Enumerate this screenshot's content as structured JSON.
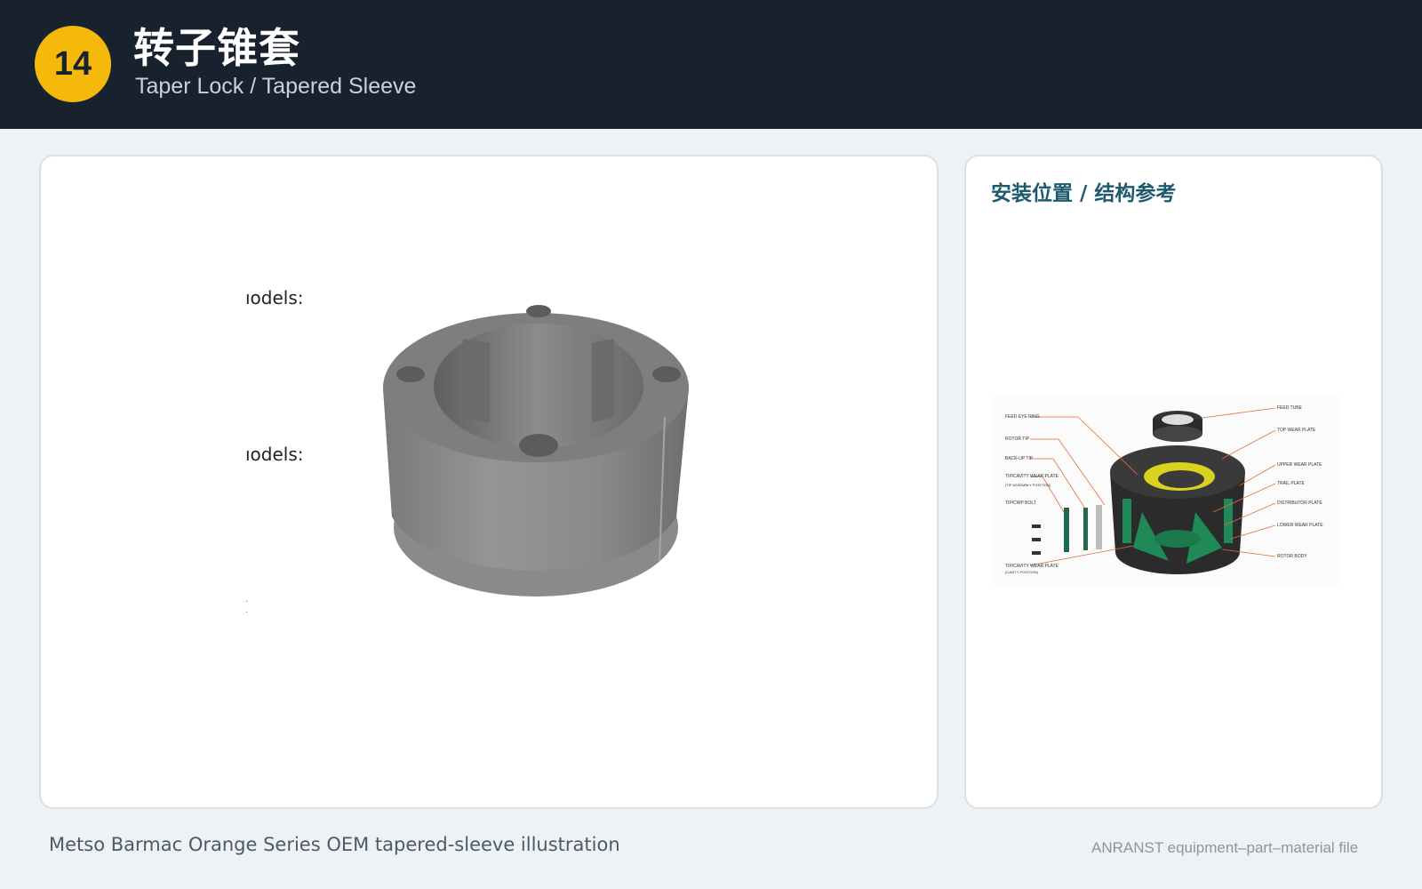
{
  "header": {
    "number": "14",
    "title_cn": "转子锥套",
    "title_en": "Taper Lock / Tapered Sleeve"
  },
  "main_image": {
    "fragments": [
      "ıodels:",
      "ıodels:"
    ]
  },
  "side_panel": {
    "title": "安装位置 / 结构参考",
    "diagram_labels_left": [
      "FEED EYE RING",
      "ROTOR TIP",
      "BACK-UP TIP",
      "TIP/CAVITY WEAR PLATE",
      "(TIP ASSEMBLY POSITION)",
      "TIP/CWP BOLT",
      "TIP/CAVITY WEAR PLATE",
      "(CAVITY POSITION)"
    ],
    "diagram_labels_right": [
      "FEED TUBE",
      "TOP WEAR PLATE",
      "UPPER WEAR PLATE",
      "TRAIL PLATE",
      "DISTRIBUTOR PLATE",
      "LOWER WEAR PLATE",
      "ROTOR BODY"
    ]
  },
  "footer": {
    "caption": "Metso Barmac Orange Series OEM tapered-sleeve illustration",
    "source": "ANRANST equipment–part–material file"
  },
  "colors": {
    "header_bg": "#17222e",
    "badge": "#f5b90c",
    "accent_title": "#1d5a6e",
    "page_bg": "#eef2f5"
  }
}
